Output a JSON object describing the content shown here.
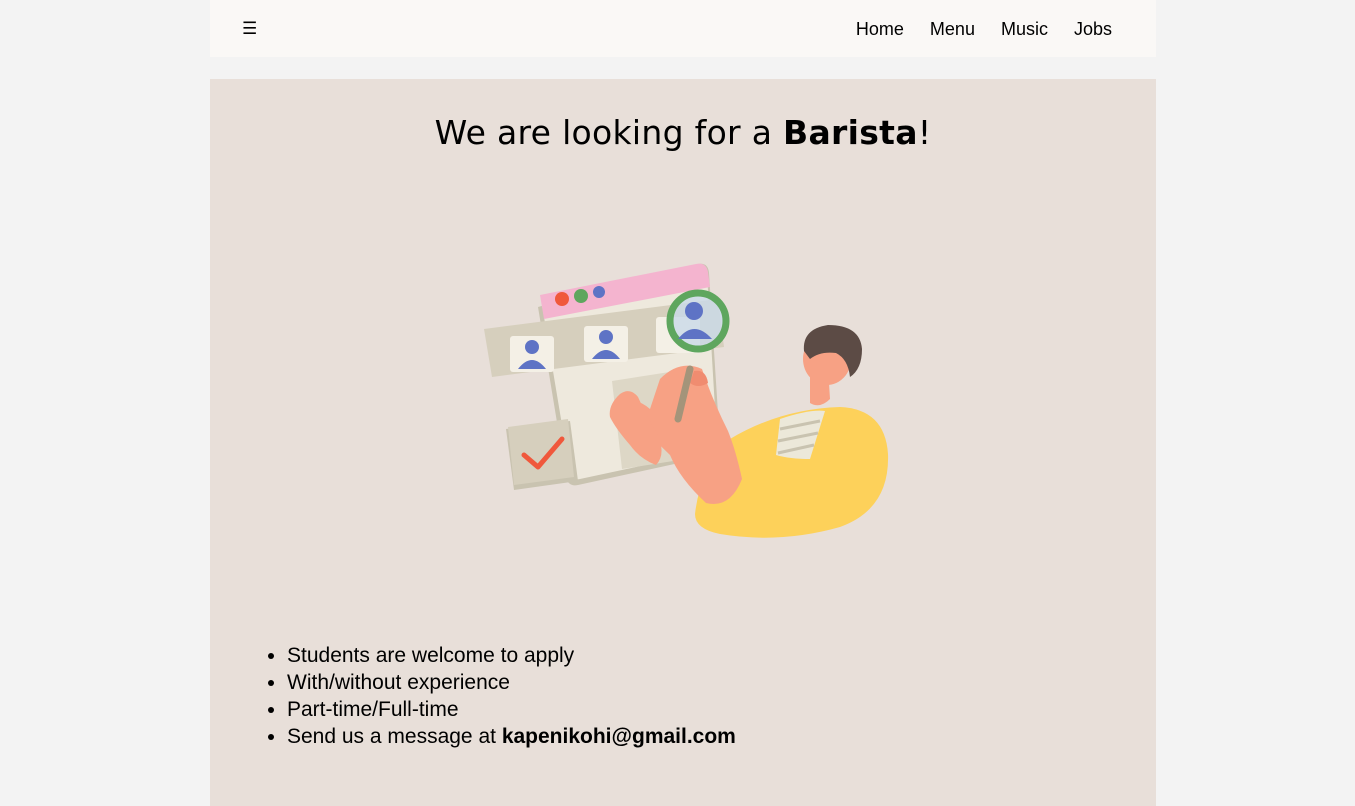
{
  "nav": {
    "menu_toggle_icon": "hamburger-icon",
    "menu_toggle_glyph": "☰",
    "links": [
      "Home",
      "Menu",
      "Music",
      "Jobs"
    ]
  },
  "hero": {
    "headline_prefix": "We are looking for a ",
    "headline_role": "Barista",
    "headline_suffix": "!",
    "illustration": "recruiter-with-magnifying-glass-illustration",
    "perks": [
      "Students are welcome to apply",
      "With/without experience",
      "Part-time/Full-time"
    ],
    "contact_prefix": "Send us a message at ",
    "contact_email": "kapenikohi@gmail.com"
  },
  "colors": {
    "page_background": "#f3f3f3",
    "topbar_background": "#faf8f6",
    "hero_background": "#e8dfd9"
  }
}
